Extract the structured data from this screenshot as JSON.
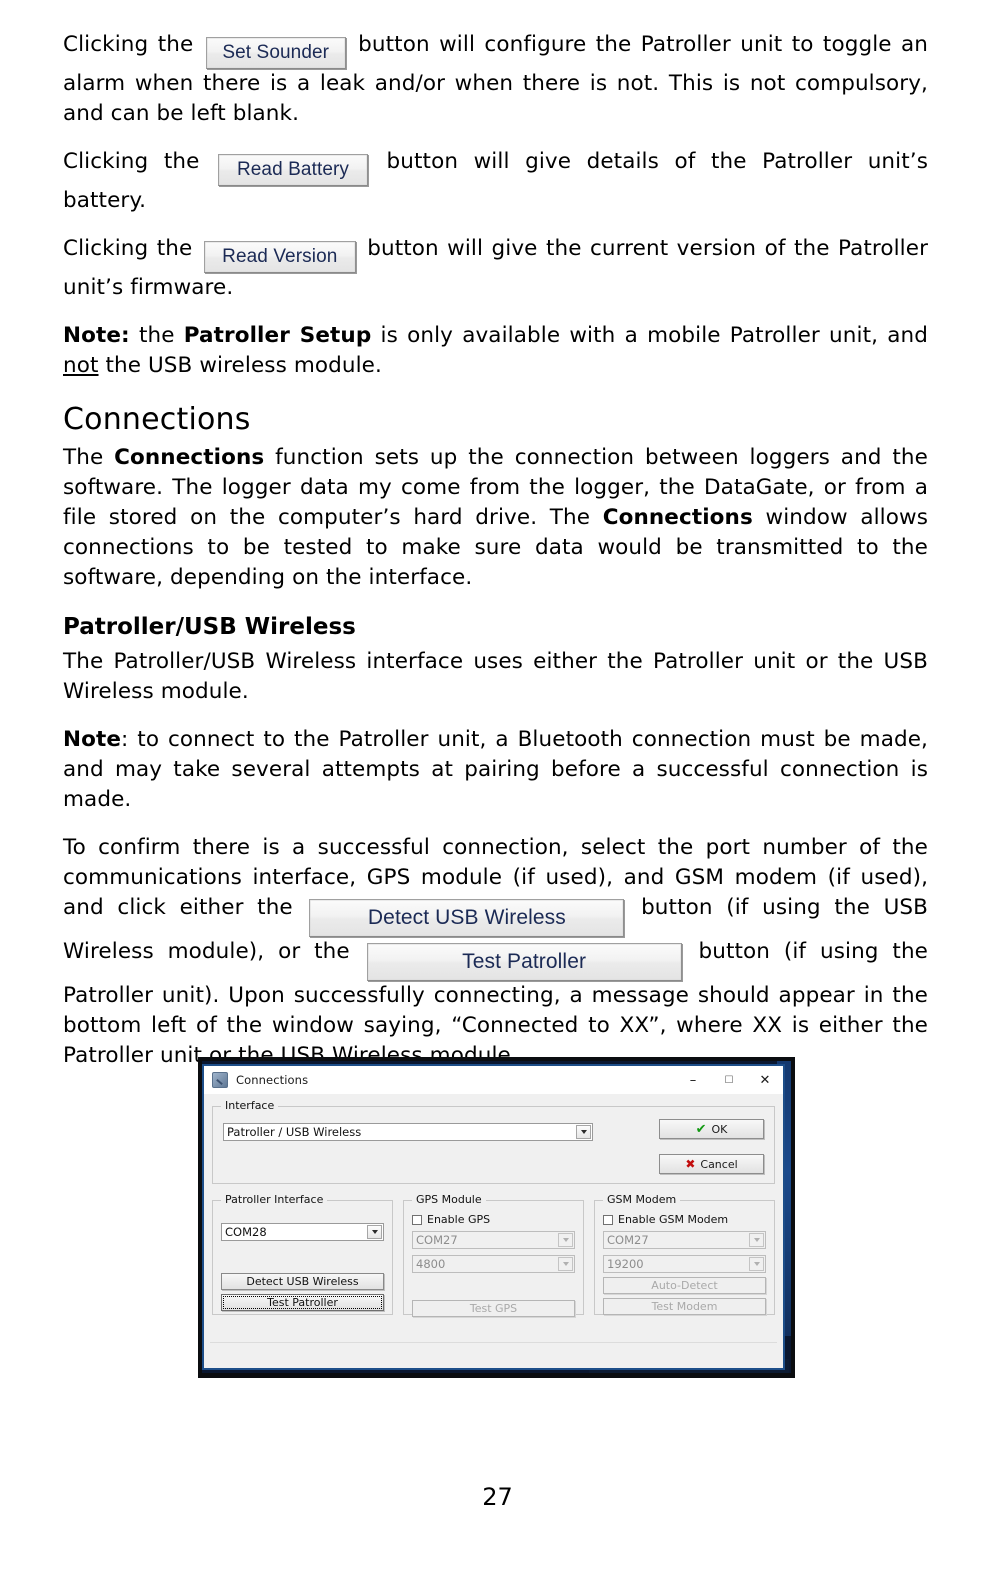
{
  "document": {
    "page_number": "27",
    "paragraphs": {
      "p1_pre": "Clicking the",
      "p1_btn": "Set Sounder",
      "p1_post": "button will configure the Patroller unit to toggle an alarm when there is a leak and/or when there is not. This is not compulsory, and can be left blank.",
      "p2_pre": "Clicking the",
      "p2_btn": "Read Battery",
      "p2_post": "button will give details of the Patroller unit’s battery.",
      "p3_pre": "Clicking the",
      "p3_btn": "Read Version",
      "p3_post": "button will give the current version of the Patroller unit’s firmware.",
      "note1_label": "Note:",
      "note1_a": " the ",
      "note1_bold": "Patroller Setup",
      "note1_b": " is only available with a mobile Patroller unit, and ",
      "note1_u": "not",
      "note1_c": " the USB wireless module.",
      "section_heading": "Connections",
      "p4_a": "The ",
      "p4_b1": "Connections",
      "p4_b": " function sets up the connection between loggers and the software. The logger data my come from the logger, the DataGate, or from a file stored on the computer’s hard drive. The ",
      "p4_b2": "Connections",
      "p4_c": " window allows connections to be tested to make sure data would be transmitted to the software, depending on the interface.",
      "sub_heading": "Patroller/USB Wireless",
      "p5": "The Patroller/USB Wireless interface uses either the Patroller unit or the USB Wireless module.",
      "note2_label": "Note",
      "note2_text": ": to connect to the Patroller unit, a Bluetooth connection must be made, and may take several attempts at pairing before a successful connection is made.",
      "p6_a": "To confirm there is a successful connection, select the port number of the communications interface, GPS module (if used), and GSM modem (if used), and click either the",
      "p6_btn1": "Detect USB Wireless",
      "p6_b": "button (if using the USB Wireless module), or the",
      "p6_btn2": "Test Patroller",
      "p6_c": "button (if using the Patroller unit). Upon successfully connecting, a message should appear in the bottom left of the window saying, “Connected to XX”, where XX is either the Patroller unit or the USB Wireless module."
    }
  },
  "dialog": {
    "title": "Connections",
    "titlebar": {
      "minimize": "–",
      "maximize": "☐",
      "close": "✕"
    },
    "interface_group": {
      "legend": "Interface",
      "value": "Patroller / USB Wireless"
    },
    "ok_button": "OK",
    "cancel_button": "Cancel",
    "patroller_group": {
      "legend": "Patroller Interface",
      "port": "COM28",
      "detect_button": "Detect USB Wireless",
      "test_button": "Test Patroller"
    },
    "gps_group": {
      "legend": "GPS Module",
      "enable_label": "Enable GPS",
      "enabled": false,
      "port": "COM27",
      "baud": "4800",
      "test_button": "Test GPS"
    },
    "gsm_group": {
      "legend": "GSM Modem",
      "enable_label": "Enable GSM Modem",
      "enabled": false,
      "port": "COM27",
      "baud": "19200",
      "autodetect_button": "Auto-Detect",
      "test_button": "Test Modem"
    },
    "status_text": ""
  },
  "colors": {
    "dialog_border": "#1d4e89",
    "button_text": "#1b2a55",
    "ok_tick": "#119911",
    "cancel_cross": "#c20d0d"
  }
}
